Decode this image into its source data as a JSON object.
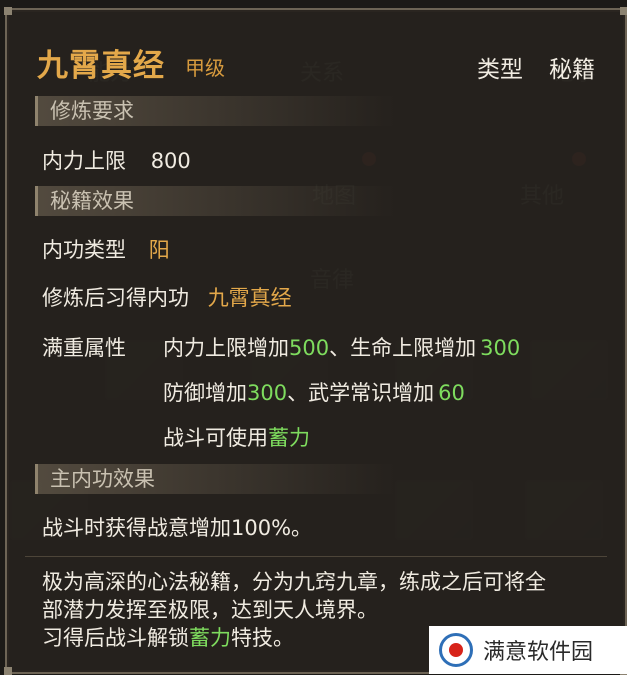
{
  "background": {
    "tabs": [
      "能力",
      "关系",
      "地图",
      "其他",
      "记事",
      "音律"
    ]
  },
  "header": {
    "title": "九霄真经",
    "grade": "甲级",
    "type_label": "类型",
    "type_value": "秘籍"
  },
  "requirements": {
    "section_title": "修炼要求",
    "label": "内力上限",
    "value": "800"
  },
  "effects": {
    "section_title": "秘籍效果",
    "inner_type_label": "内功类型",
    "inner_type_value": "阳",
    "learned_label": "修炼后习得内功",
    "learned_value": "九霄真经",
    "full_label": "满重属性",
    "line1": {
      "a": "内力上限增加",
      "a_val": "500",
      "sep": "、生命上限增加",
      "b_val": "300"
    },
    "line2": {
      "a": "防御增加",
      "a_val": "300",
      "sep": "、武学常识增加",
      "b_val": "60"
    },
    "line3": {
      "a": "战斗可使用",
      "b": "蓄力"
    }
  },
  "main_effect": {
    "section_title": "主内功效果",
    "text": "战斗时获得战意增加100%。"
  },
  "description": {
    "line1": "极为高深的心法秘籍，分为九窍九章，练成之后可将全",
    "line2": "部潜力发挥至极限，达到天人境界。",
    "line3_a": "习得后战斗解锁",
    "line3_b": "蓄力",
    "line3_c": "特技。"
  },
  "watermark": {
    "text": "满意软件园"
  },
  "colors": {
    "title": "#e3a84a",
    "highlight_green": "#7edc5e",
    "text": "#f0ebe1"
  }
}
